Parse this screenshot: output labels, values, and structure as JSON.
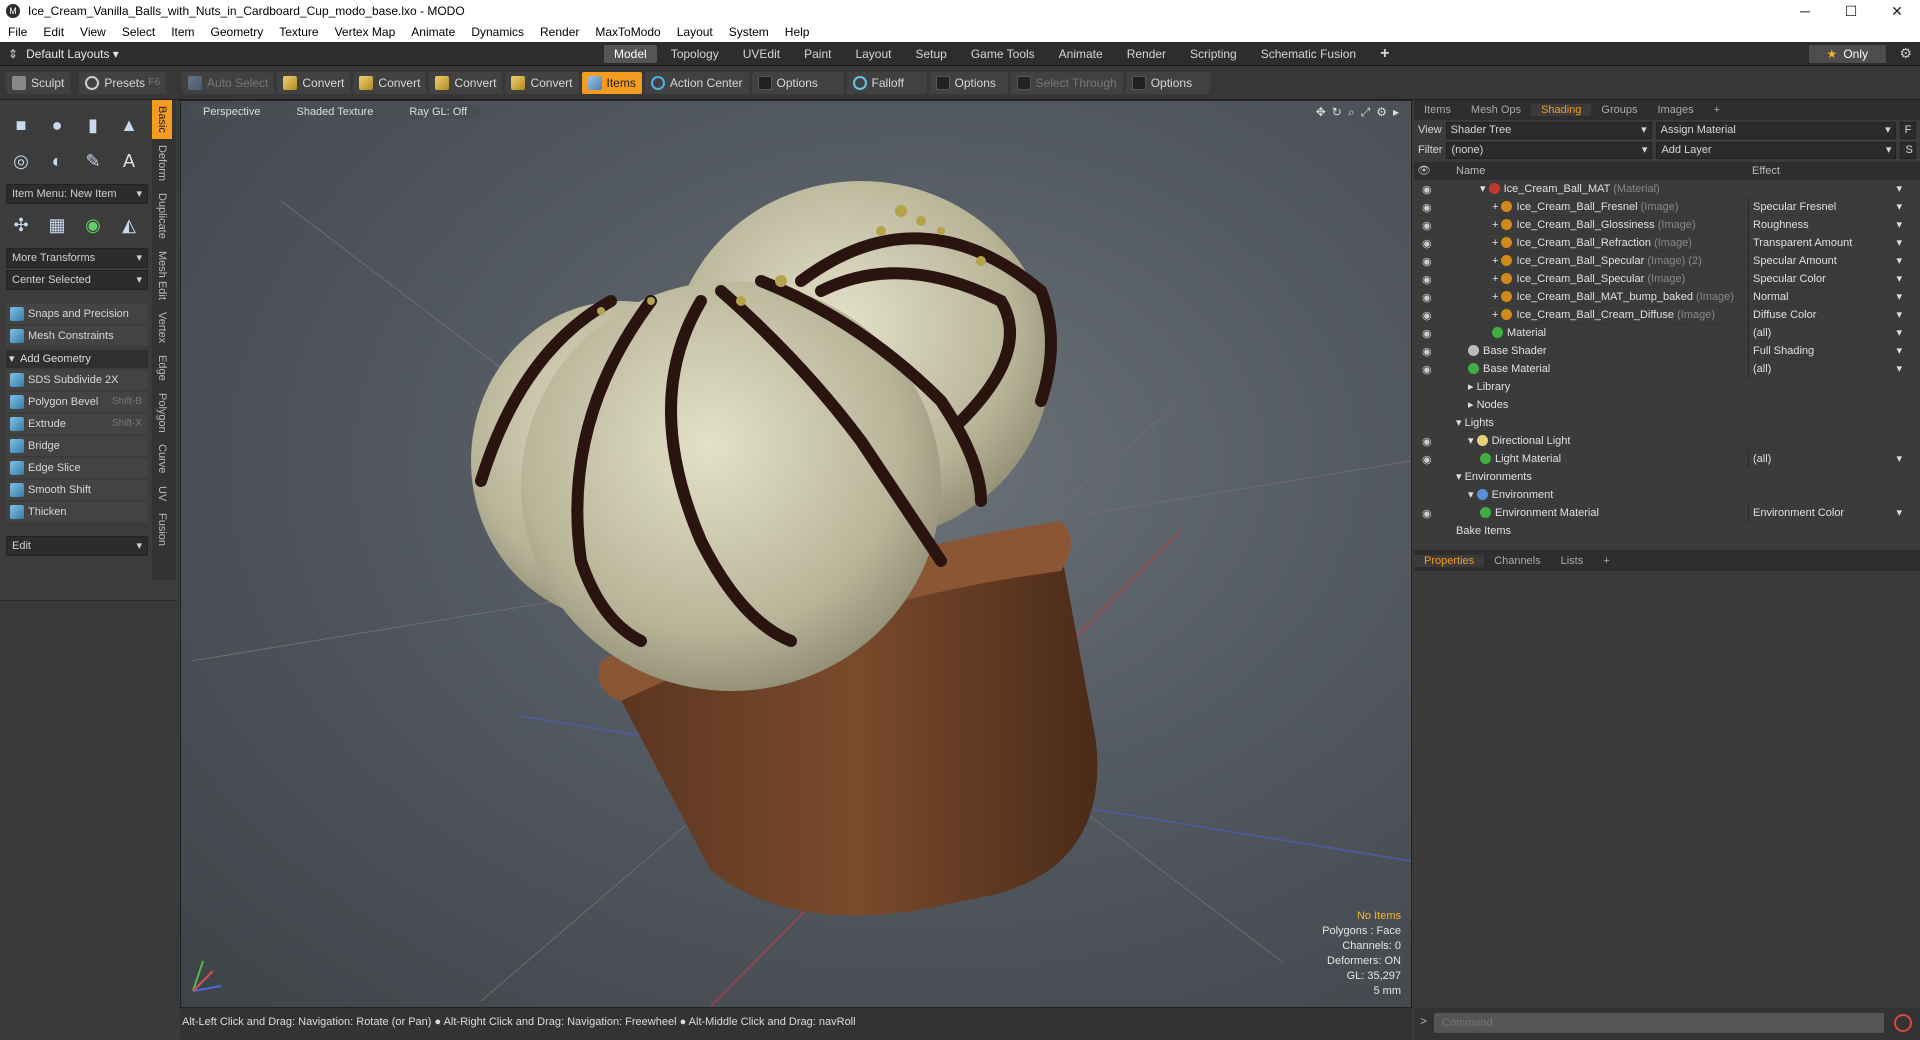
{
  "window": {
    "title": "Ice_Cream_Vanilla_Balls_with_Nuts_in_Cardboard_Cup_modo_base.lxo - MODO",
    "minimize": "─",
    "maximize": "☐",
    "close": "✕"
  },
  "menu": [
    "File",
    "Edit",
    "View",
    "Select",
    "Item",
    "Geometry",
    "Texture",
    "Vertex Map",
    "Animate",
    "Dynamics",
    "Render",
    "MaxToModo",
    "Layout",
    "System",
    "Help"
  ],
  "layouts": {
    "label": "Default Layouts"
  },
  "modetabs": [
    "Model",
    "Topology",
    "UVEdit",
    "Paint",
    "Layout",
    "Setup",
    "Game Tools",
    "Animate",
    "Render",
    "Scripting",
    "Schematic Fusion",
    "+"
  ],
  "only": "Only",
  "toolbar": {
    "sculpt": "Sculpt",
    "presets": "Presets",
    "presets_key": "F6",
    "auto_select": "Auto Select",
    "convert": "Convert",
    "items": "Items",
    "action_center": "Action Center",
    "options": "Options",
    "falloff": "Falloff",
    "select_through": "Select Through"
  },
  "left": {
    "item_menu": "Item Menu: New Item",
    "more_transforms": "More Transforms",
    "center_selected": "Center Selected",
    "snaps": "Snaps and Precision",
    "mesh_constraints": "Mesh Constraints",
    "add_geometry": "Add Geometry",
    "edit": "Edit",
    "tools": [
      {
        "label": "SDS Subdivide 2X",
        "key": ""
      },
      {
        "label": "Polygon Bevel",
        "key": "Shift-B"
      },
      {
        "label": "Extrude",
        "key": "Shift-X"
      },
      {
        "label": "Bridge",
        "key": ""
      },
      {
        "label": "Edge Slice",
        "key": ""
      },
      {
        "label": "Smooth Shift",
        "key": ""
      },
      {
        "label": "Thicken",
        "key": ""
      }
    ],
    "vtabs": [
      "Basic",
      "Deform",
      "Duplicate",
      "Mesh Edit",
      "Vertex",
      "Edge",
      "Polygon",
      "Curve",
      "UV",
      "Fusion"
    ]
  },
  "viewport": {
    "perspective": "Perspective",
    "shading": "Shaded Texture",
    "raygl": "Ray GL: Off",
    "stats": {
      "items": "No Items",
      "polygons": "Polygons : Face",
      "channels": "Channels: 0",
      "deformers": "Deformers: ON",
      "gl": "GL: 35,297",
      "scale": "5 mm"
    }
  },
  "status": "Alt-Left Click and Drag: Navigation: Rotate (or Pan) ● Alt-Right Click and Drag: Navigation: Freewheel ● Alt-Middle Click and Drag: navRoll",
  "right": {
    "tabs": [
      "Items",
      "Mesh Ops",
      "Shading",
      "Groups",
      "Images",
      "+"
    ],
    "view_label": "View",
    "view_value": "Shader Tree",
    "assign": "Assign Material",
    "filter_label": "Filter",
    "filter_value": "(none)",
    "add_layer": "Add Layer",
    "f": "F",
    "s": "S",
    "col_name": "Name",
    "col_effect": "Effect",
    "rows": [
      {
        "indent": 3,
        "name": "Ice_Cream_Ball_MAT",
        "type": "(Material)",
        "effect": "",
        "dot": "#c0392b",
        "eye": true,
        "exp": "▾"
      },
      {
        "indent": 4,
        "name": "Ice_Cream_Ball_Fresnel",
        "type": "(Image)",
        "effect": "Specular Fresnel",
        "dot": "#d08a1a",
        "eye": true,
        "exp": "+"
      },
      {
        "indent": 4,
        "name": "Ice_Cream_Ball_Glossiness",
        "type": "(Image)",
        "effect": "Roughness",
        "dot": "#d08a1a",
        "eye": true,
        "exp": "+"
      },
      {
        "indent": 4,
        "name": "Ice_Cream_Ball_Refraction",
        "type": "(Image)",
        "effect": "Transparent Amount",
        "dot": "#d08a1a",
        "eye": true,
        "exp": "+"
      },
      {
        "indent": 4,
        "name": "Ice_Cream_Ball_Specular",
        "type": "(Image) (2)",
        "effect": "Specular Amount",
        "dot": "#d08a1a",
        "eye": true,
        "exp": "+"
      },
      {
        "indent": 4,
        "name": "Ice_Cream_Ball_Specular",
        "type": "(Image)",
        "effect": "Specular Color",
        "dot": "#d08a1a",
        "eye": true,
        "exp": "+"
      },
      {
        "indent": 4,
        "name": "Ice_Cream_Ball_MAT_bump_baked",
        "type": "(Image)",
        "effect": "Normal",
        "dot": "#d08a1a",
        "eye": true,
        "exp": "+"
      },
      {
        "indent": 4,
        "name": "Ice_Cream_Ball_Cream_Diffuse",
        "type": "(Image)",
        "effect": "Diffuse Color",
        "dot": "#d08a1a",
        "eye": true,
        "exp": "+"
      },
      {
        "indent": 4,
        "name": "Material",
        "type": "",
        "effect": "(all)",
        "dot": "#3fae3f",
        "eye": true,
        "exp": ""
      },
      {
        "indent": 2,
        "name": "Base Shader",
        "type": "",
        "effect": "Full Shading",
        "dot": "#bbbbbb",
        "eye": true,
        "exp": ""
      },
      {
        "indent": 2,
        "name": "Base Material",
        "type": "",
        "effect": "(all)",
        "dot": "#3fae3f",
        "eye": true,
        "exp": ""
      },
      {
        "indent": 2,
        "name": "Library",
        "type": "",
        "effect": "",
        "dot": "",
        "eye": false,
        "exp": "▸"
      },
      {
        "indent": 2,
        "name": "Nodes",
        "type": "",
        "effect": "",
        "dot": "",
        "eye": false,
        "exp": "▸"
      },
      {
        "indent": 1,
        "name": "Lights",
        "type": "",
        "effect": "",
        "dot": "",
        "eye": false,
        "exp": "▾"
      },
      {
        "indent": 2,
        "name": "Directional Light",
        "type": "",
        "effect": "",
        "dot": "#e8d07a",
        "eye": true,
        "exp": "▾"
      },
      {
        "indent": 3,
        "name": "Light Material",
        "type": "",
        "effect": "(all)",
        "dot": "#3fae3f",
        "eye": true,
        "exp": ""
      },
      {
        "indent": 1,
        "name": "Environments",
        "type": "",
        "effect": "",
        "dot": "",
        "eye": false,
        "exp": "▾"
      },
      {
        "indent": 2,
        "name": "Environment",
        "type": "",
        "effect": "",
        "dot": "#5a8fd6",
        "eye": false,
        "exp": "▾"
      },
      {
        "indent": 3,
        "name": "Environment Material",
        "type": "",
        "effect": "Environment Color",
        "dot": "#3fae3f",
        "eye": true,
        "exp": ""
      },
      {
        "indent": 1,
        "name": "Bake Items",
        "type": "",
        "effect": "",
        "dot": "",
        "eye": false,
        "exp": ""
      }
    ]
  },
  "props": {
    "tabs": [
      "Properties",
      "Channels",
      "Lists",
      "+"
    ]
  },
  "command": {
    "placeholder": "Command"
  }
}
